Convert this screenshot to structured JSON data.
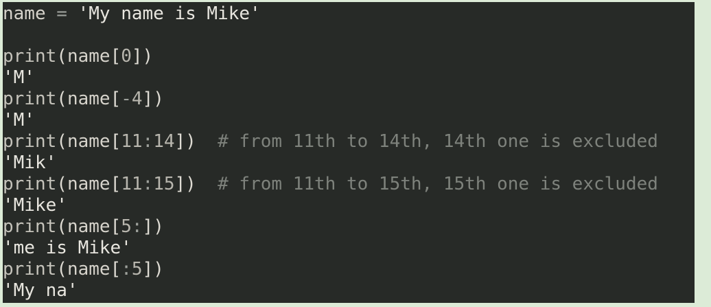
{
  "editor": {
    "lines": [
      {
        "kind": "code",
        "text": "name = 'My name is Mike'"
      },
      {
        "kind": "blank",
        "text": ""
      },
      {
        "kind": "code",
        "text": "print(name[0])"
      },
      {
        "kind": "output",
        "text": "'M'"
      },
      {
        "kind": "code",
        "text": "print(name[-4])"
      },
      {
        "kind": "output",
        "text": "'M'"
      },
      {
        "kind": "code",
        "text": "print(name[11:14])  # from 11th to 14th, 14th one is excluded"
      },
      {
        "kind": "output",
        "text": "'Mik'"
      },
      {
        "kind": "code",
        "text": "print(name[11:15])  # from 11th to 15th, 15th one is excluded"
      },
      {
        "kind": "output",
        "text": "'Mike'"
      },
      {
        "kind": "code",
        "text": "print(name[5:])"
      },
      {
        "kind": "output",
        "text": "'me is Mike'"
      },
      {
        "kind": "code",
        "text": "print(name[:5])"
      },
      {
        "kind": "output",
        "text": "'My na'"
      }
    ]
  },
  "colors": {
    "background": "#272a27",
    "frame": "#dcebd7",
    "text": "#e8e6df",
    "comment": "#7e827c"
  }
}
